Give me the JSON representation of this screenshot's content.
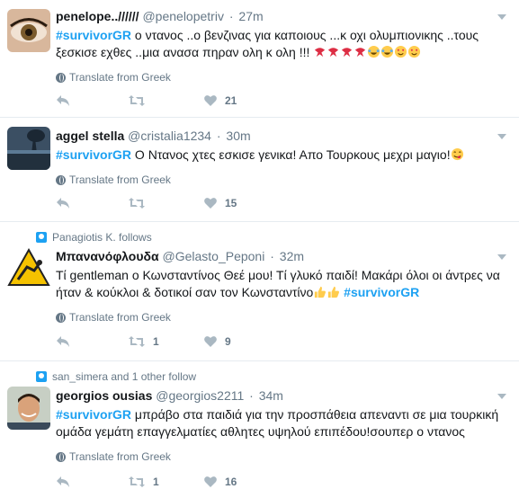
{
  "tweets": [
    {
      "context": "",
      "fullname": "penelope..//////",
      "screen_name": "@penelopetriv",
      "time": "27m",
      "text_hashtag": "#survivorGR",
      "text_line1": " ο ντανος ..ο βενζινας για καποιους ...κ οχι ολυμπιονικης ..τους",
      "text_line2": "ξεσκισε εχθες ..μια ανασα πηραν ολη κ ολη !!! ",
      "emojis_a": [
        "bird",
        "bird",
        "bird",
        "bird"
      ],
      "emojis_b": [
        "laugh-cry",
        "laugh-cry",
        "heart-eyes",
        "heart-eyes"
      ],
      "translate": "Translate from Greek",
      "retweets": "",
      "likes": "21"
    },
    {
      "context": "",
      "fullname": "aggel stella",
      "screen_name": "@cristalia1234",
      "time": "30m",
      "text_hashtag": "#survivorGR",
      "text_line1": " Ο Ντανος χτες εσκισε γενικα! Απο Τουρκους μεχρι μαγιο!",
      "emojis_a": [
        "yum"
      ],
      "translate": "Translate from Greek",
      "retweets": "",
      "likes": "15"
    },
    {
      "context": "Panagiotis K. follows",
      "fullname": "Μπανανόφλουδα",
      "screen_name": "@Gelasto_Peponi",
      "time": "32m",
      "text_line1": "Τί gentleman ο Κωνσταντίνος Θεέ μου! Τί γλυκό παιδί! Μακάρι όλοι οι άντρες να",
      "text_line2": "ήταν & κούκλοι & δοτικοί σαν τον Κωνσταντίνο",
      "emojis_a": [
        "thumb",
        "thumb"
      ],
      "text_hashtag": "#survivorGR",
      "translate": "Translate from Greek",
      "retweets": "1",
      "likes": "9"
    },
    {
      "context": "san_simera and 1 other follow",
      "fullname": "georgios ousias",
      "screen_name": "@georgios2211",
      "time": "34m",
      "text_hashtag": "#survivorGR",
      "text_line1": " μπράβο στα παιδιά για την προσπάθεια απεναντι σε μια τουρκική",
      "text_line2": "ομάδα γεμάτη επαγγελματίες αθλητες υψηλού επιπέδου!σουπερ ο ντανος",
      "translate": "Translate from Greek",
      "retweets": "1",
      "likes": "16"
    }
  ]
}
